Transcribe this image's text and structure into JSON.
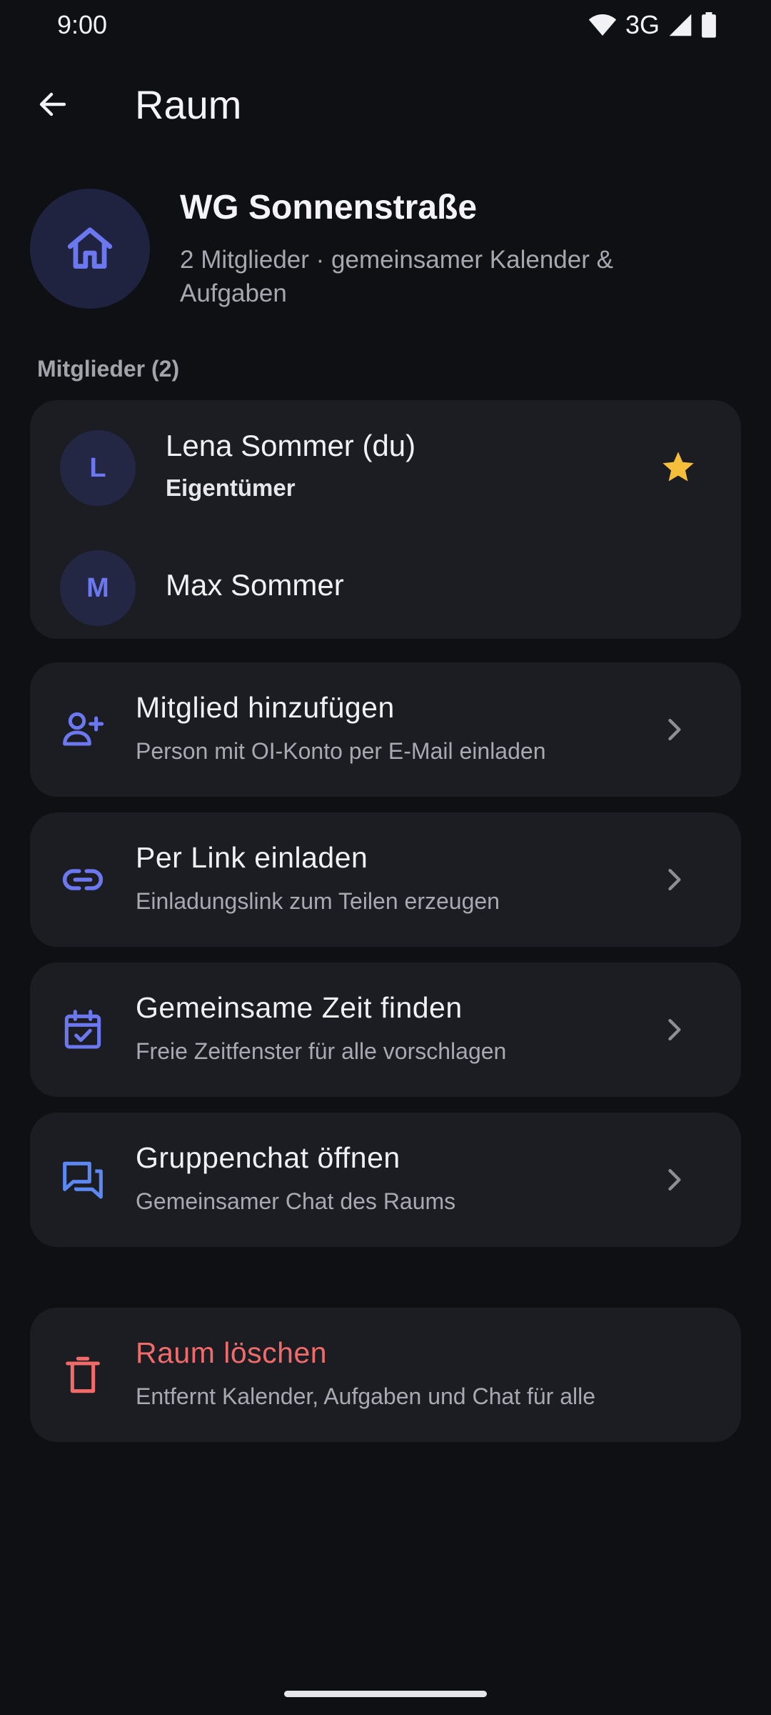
{
  "status_bar": {
    "time": "9:00",
    "network": "3G",
    "icons": [
      "wifi-icon",
      "signal-icon",
      "battery-icon"
    ]
  },
  "app_bar": {
    "title": "Raum",
    "back_icon": "arrow-left-icon"
  },
  "room": {
    "name": "WG Sonnenstraße",
    "subtitle": "2 Mitglieder · gemeinsamer Kalender & Aufgaben",
    "icon": "home-icon"
  },
  "members_section": {
    "label": "Mitglieder (2)",
    "members": [
      {
        "initial": "L",
        "name": "Lena Sommer (du)",
        "role": "Eigentümer",
        "owner_icon": "star-icon"
      },
      {
        "initial": "M",
        "name": "Max Sommer",
        "role": ""
      }
    ]
  },
  "actions": [
    {
      "title": "Mitglied hinzufügen",
      "subtitle": "Person mit OI-Konto per E-Mail einladen",
      "icon": "person-add-icon"
    },
    {
      "title": "Per Link einladen",
      "subtitle": "Einladungslink zum Teilen erzeugen",
      "icon": "link-icon"
    },
    {
      "title": "Gemeinsame Zeit finden",
      "subtitle": "Freie Zeitfenster für alle vorschlagen",
      "icon": "calendar-check-icon"
    },
    {
      "title": "Gruppenchat öffnen",
      "subtitle": "Gemeinsamer Chat des Raums",
      "icon": "forum-icon"
    }
  ],
  "danger_action": {
    "title": "Raum löschen",
    "subtitle": "Entfernt Kalender, Aufgaben und Chat für alle",
    "icon": "trash-icon"
  },
  "colors": {
    "background": "#0f1014",
    "card": "#1c1d22",
    "accent": "#6b78f0",
    "danger": "#f26b6b",
    "star": "#f5bf3c"
  }
}
